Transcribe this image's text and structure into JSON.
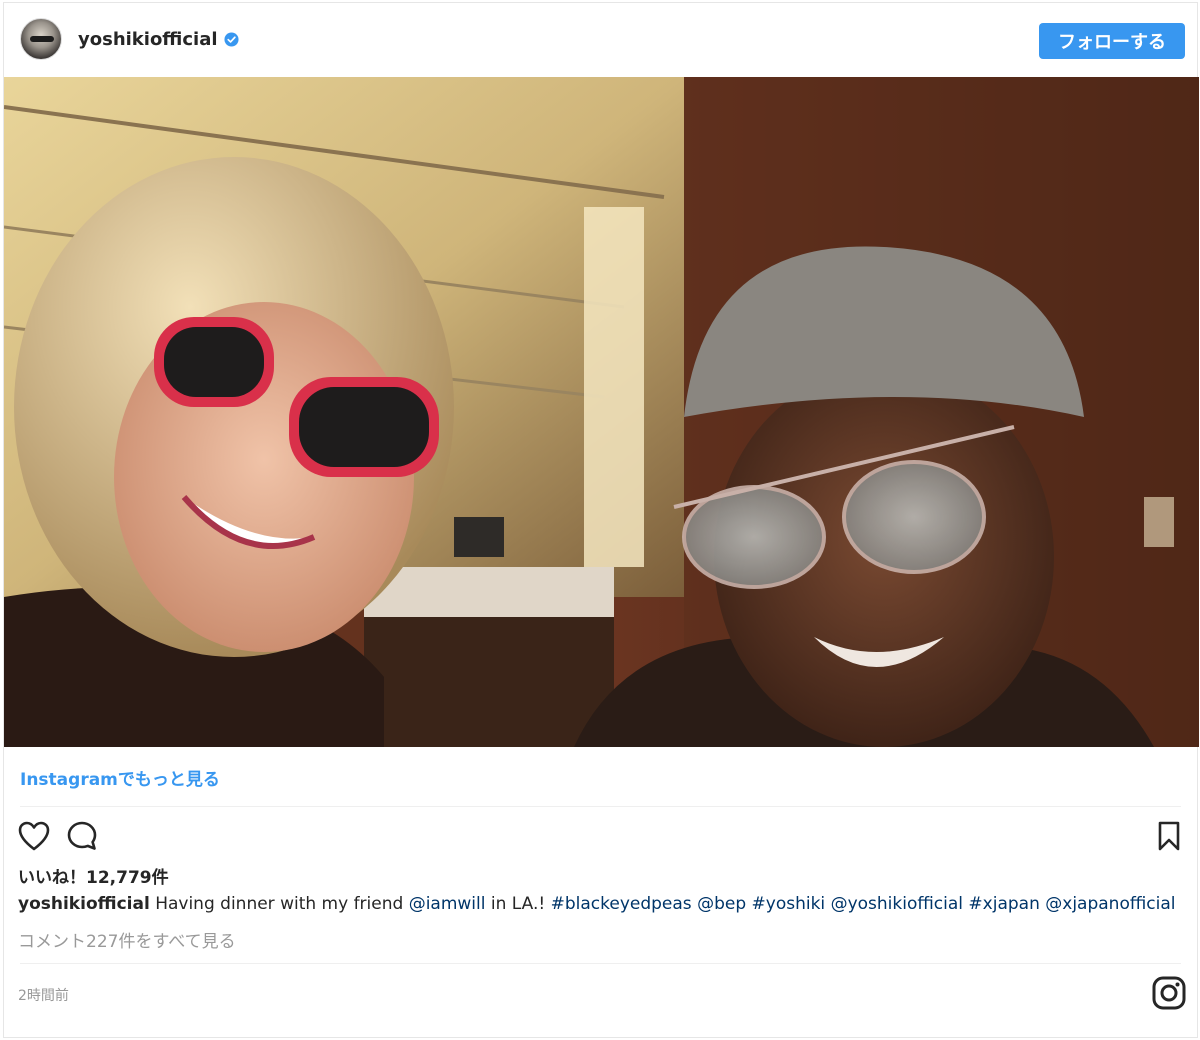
{
  "header": {
    "username": "yoshikiofficial",
    "follow_label": "フォローする"
  },
  "link": {
    "more_label": "Instagramでもっと見る"
  },
  "post": {
    "likes": "いいね！12,779件",
    "caption_user": "yoshikiofficial",
    "caption_parts": [
      {
        "text": " Having dinner with my friend ",
        "tag": false
      },
      {
        "text": "@iamwill",
        "tag": true
      },
      {
        "text": " in LA.! ",
        "tag": false
      },
      {
        "text": "#blackeyedpeas",
        "tag": true
      },
      {
        "text": " ",
        "tag": false
      },
      {
        "text": "@bep",
        "tag": true
      },
      {
        "text": " ",
        "tag": false
      },
      {
        "text": "#yoshiki",
        "tag": true
      },
      {
        "text": " ",
        "tag": false
      },
      {
        "text": "@yoshikiofficial",
        "tag": true
      },
      {
        "text": " ",
        "tag": false
      },
      {
        "text": "#xjapan",
        "tag": true
      },
      {
        "text": " ",
        "tag": false
      },
      {
        "text": "@xjapanofficial",
        "tag": true
      }
    ],
    "view_comments": "コメント227件をすべて見る",
    "timestamp": "2時間前"
  },
  "icons": {
    "verified": "verified-badge-icon",
    "like": "heart-icon",
    "comment": "comment-bubble-icon",
    "save": "bookmark-icon",
    "brand": "instagram-icon"
  },
  "colors": {
    "accent": "#3897f0",
    "tag": "#003569",
    "muted": "#999999"
  }
}
